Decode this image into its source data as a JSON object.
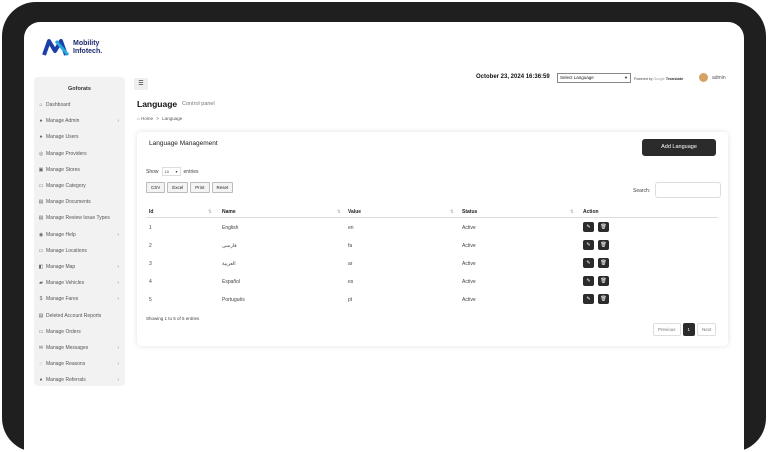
{
  "brand": {
    "line1": "Mobility",
    "line2": "Infotech."
  },
  "sidebar": {
    "title": "Goforats",
    "items": [
      {
        "label": "Dashboard",
        "icon": "dashboard-icon",
        "glyph": "⌂",
        "chevron": false
      },
      {
        "label": "Manage Admin",
        "icon": "user-icon",
        "glyph": "●",
        "chevron": true
      },
      {
        "label": "Manage Users",
        "icon": "users-icon",
        "glyph": "●",
        "chevron": false
      },
      {
        "label": "Manage Providers",
        "icon": "provider-icon",
        "glyph": "◎",
        "chevron": false
      },
      {
        "label": "Manage Stores",
        "icon": "store-icon",
        "glyph": "▣",
        "chevron": false
      },
      {
        "label": "Manage Category",
        "icon": "category-icon",
        "glyph": "▭",
        "chevron": false
      },
      {
        "label": "Manage Documents",
        "icon": "document-icon",
        "glyph": "▤",
        "chevron": false
      },
      {
        "label": "Manage Review Issue Types",
        "icon": "review-icon",
        "glyph": "▤",
        "chevron": false
      },
      {
        "label": "Manage Help",
        "icon": "help-icon",
        "glyph": "◉",
        "chevron": true
      },
      {
        "label": "Manage Locations",
        "icon": "location-icon",
        "glyph": "▭",
        "chevron": false
      },
      {
        "label": "Manage Map",
        "icon": "map-icon",
        "glyph": "◧",
        "chevron": true
      },
      {
        "label": "Manage Vehicles",
        "icon": "vehicle-icon",
        "glyph": "▰",
        "chevron": true
      },
      {
        "label": "Manage Fares",
        "icon": "fare-icon",
        "glyph": "$",
        "chevron": true
      },
      {
        "label": "Deleted Account Reports",
        "icon": "report-icon",
        "glyph": "▤",
        "chevron": false
      },
      {
        "label": "Manage Orders",
        "icon": "order-icon",
        "glyph": "▭",
        "chevron": false
      },
      {
        "label": "Manage Messages",
        "icon": "message-icon",
        "glyph": "✉",
        "chevron": true
      },
      {
        "label": "Manage Reasons",
        "icon": "reason-icon",
        "glyph": "◌",
        "chevron": true
      },
      {
        "label": "Manage Referrals",
        "icon": "referral-icon",
        "glyph": "●",
        "chevron": true
      }
    ]
  },
  "topbar": {
    "datetime": "October 23, 2024 16:36:59",
    "language_select": "Select Language",
    "powered_by": "Powered by",
    "google": "Google",
    "translate": "Translate",
    "user": "admin"
  },
  "page": {
    "title": "Language",
    "subtitle": "Control panel",
    "breadcrumb_home": "Home",
    "breadcrumb_sep": ">",
    "breadcrumb_current": "Language"
  },
  "card": {
    "title": "Language Management",
    "add_button": "Add Language",
    "show_label": "Show",
    "entries_value": "10",
    "entries_label": "entries",
    "export_buttons": [
      "CSV",
      "Excel",
      "Print",
      "Reset"
    ],
    "search_label": "Search:",
    "columns": [
      "Id",
      "Name",
      "Value",
      "Status",
      "Action"
    ],
    "rows": [
      {
        "id": "1",
        "name": "English",
        "value": "en",
        "status": "Active"
      },
      {
        "id": "2",
        "name": "فارسی",
        "value": "fa",
        "status": "Active"
      },
      {
        "id": "3",
        "name": "العربية",
        "value": "ar",
        "status": "Active"
      },
      {
        "id": "4",
        "name": "Español",
        "value": "es",
        "status": "Active"
      },
      {
        "id": "5",
        "name": "Português",
        "value": "pt",
        "status": "Active"
      }
    ],
    "info": "Showing 1 to 5 of 5 entries",
    "pager": {
      "prev": "Previous",
      "page": "1",
      "next": "Next"
    }
  }
}
